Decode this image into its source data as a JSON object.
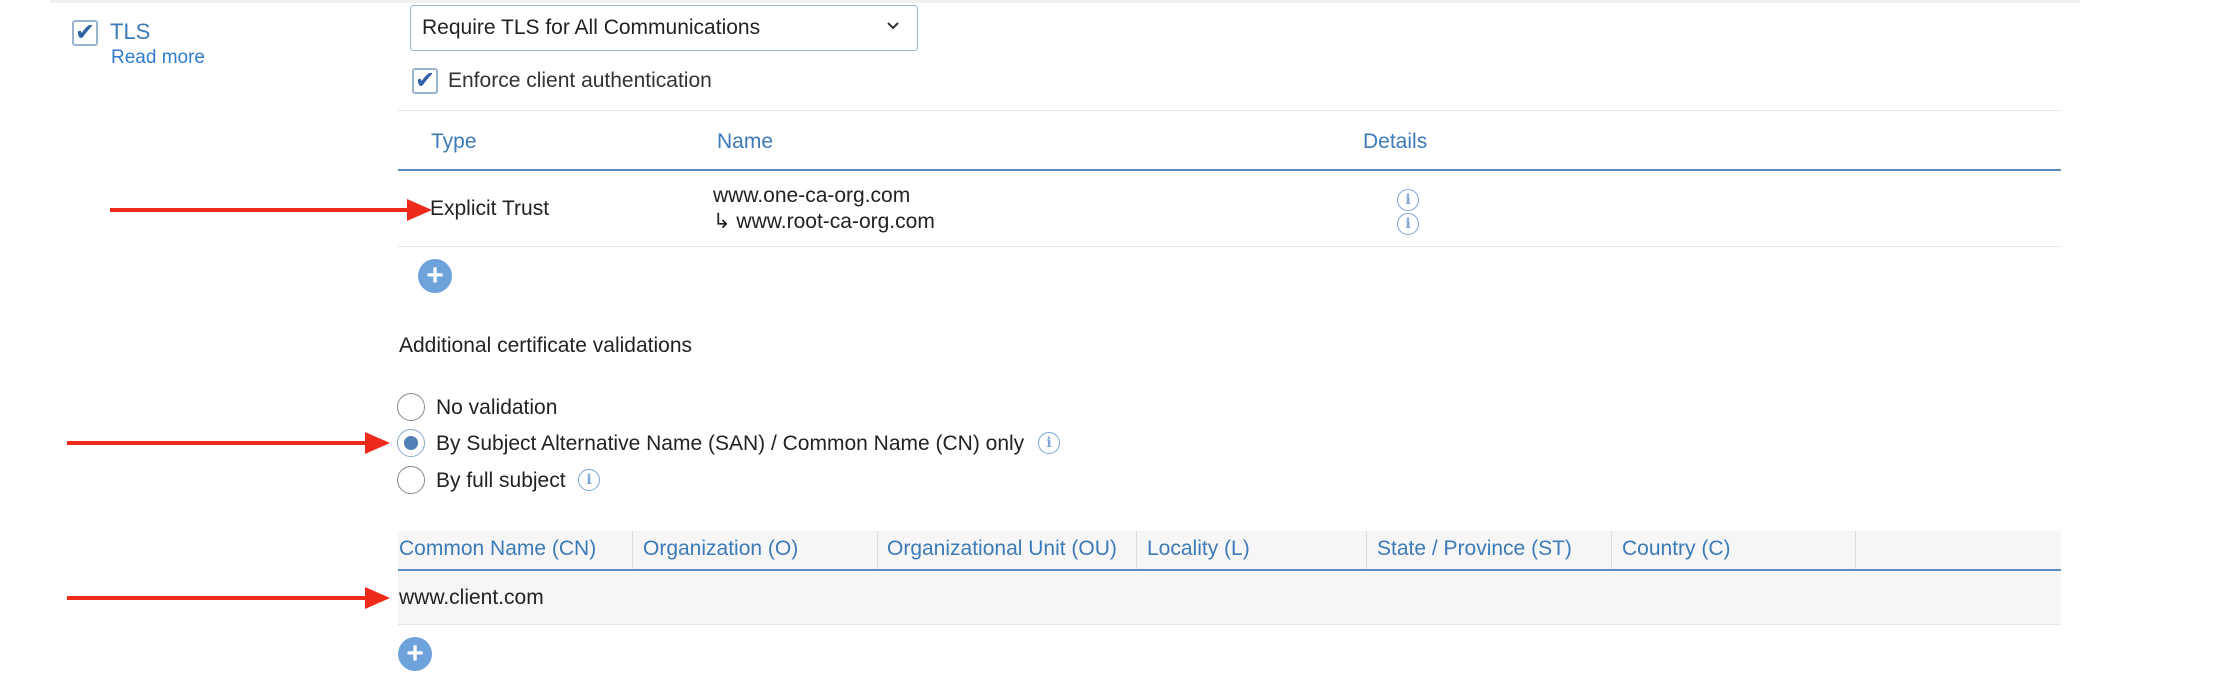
{
  "tls": {
    "label": "TLS",
    "checked": true,
    "read_more": "Read more"
  },
  "tls_mode": {
    "selected": "Require TLS for All Communications"
  },
  "enforce_client_auth": {
    "label": "Enforce client authentication",
    "checked": true
  },
  "trust_table": {
    "headers": [
      "Type",
      "Name",
      "Details"
    ],
    "rows": [
      {
        "type": "Explicit Trust",
        "names": [
          "www.one-ca-org.com",
          "↳ www.root-ca-org.com"
        ],
        "details_icons": [
          "info-icon",
          "info-icon"
        ]
      }
    ]
  },
  "additional_validations": {
    "title": "Additional certificate validations",
    "options": [
      {
        "label": "No validation",
        "selected": false
      },
      {
        "label": "By Subject Alternative Name (SAN) / Common Name (CN) only",
        "selected": true,
        "has_info": true
      },
      {
        "label": "By full subject",
        "selected": false,
        "has_info": true
      }
    ]
  },
  "subject_table": {
    "headers": [
      "Common Name (CN)",
      "Organization (O)",
      "Organizational Unit (OU)",
      "Locality (L)",
      "State / Province (ST)",
      "Country (C)"
    ],
    "rows": [
      {
        "cn": "www.client.com",
        "o": "",
        "ou": "",
        "l": "",
        "st": "",
        "c": ""
      }
    ]
  },
  "colors": {
    "accent": "#3d7ab8",
    "link": "#2f7ccf",
    "add_button": "#6da2db",
    "annotation_arrow": "#ee2b1a",
    "header_rule": "#5b8cc0"
  },
  "annotations": {
    "arrows": [
      "explicit-trust-row",
      "san-cn-option",
      "client-cn-row"
    ]
  }
}
